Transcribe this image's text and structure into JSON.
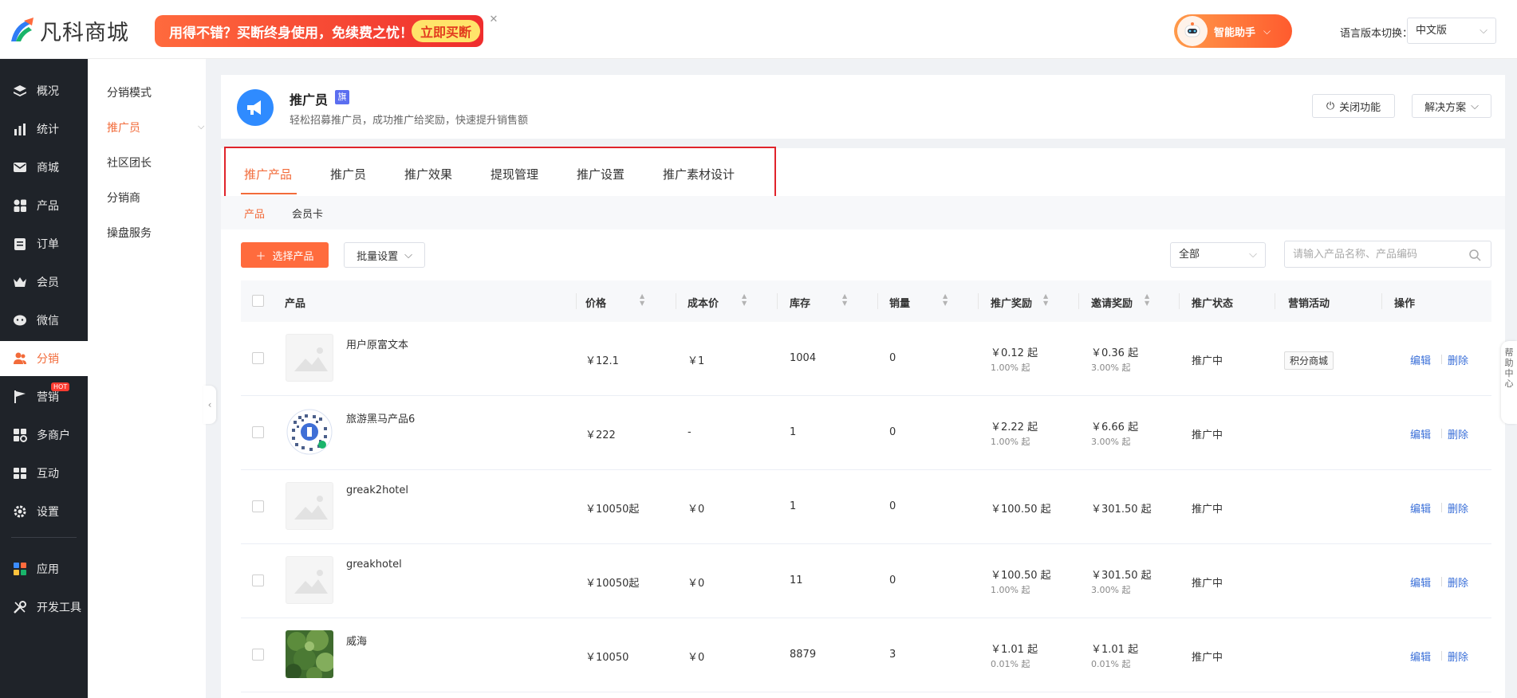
{
  "topbar": {
    "logo_text": "凡科商城",
    "promo_text": "用得不错？买断终身使用，免续费之忧！",
    "promo_button": "立即买断",
    "assistant_label": "智能助手",
    "lang_label": "语言版本切换：",
    "lang_value": "中文版"
  },
  "nav": {
    "items": [
      {
        "label": "概况",
        "icon": "layers-icon"
      },
      {
        "label": "统计",
        "icon": "stats-icon"
      },
      {
        "label": "商城",
        "icon": "mail-icon"
      },
      {
        "label": "产品",
        "icon": "grid-icon"
      },
      {
        "label": "订单",
        "icon": "clipboard-icon"
      },
      {
        "label": "会员",
        "icon": "crown-icon"
      },
      {
        "label": "微信",
        "icon": "wechat-icon"
      },
      {
        "label": "分销",
        "icon": "users-icon"
      },
      {
        "label": "营销",
        "icon": "flag-icon",
        "badge": "HOT"
      },
      {
        "label": "多商户",
        "icon": "store-icon"
      },
      {
        "label": "互动",
        "icon": "interact-icon"
      },
      {
        "label": "设置",
        "icon": "gear-icon"
      },
      {
        "label": "应用",
        "icon": "apps-icon"
      },
      {
        "label": "开发工具",
        "icon": "tools-icon"
      }
    ]
  },
  "subnav": {
    "items": [
      "分销模式",
      "推广员",
      "社区团长",
      "分销商",
      "操盘服务"
    ]
  },
  "header": {
    "title": "推广员",
    "badge": "旗",
    "desc": "轻松招募推广员，成功推广给奖励，快速提升销售额",
    "close_btn": "关闭功能",
    "solution_btn": "解决方案"
  },
  "tabs": [
    "推广产品",
    "推广员",
    "推广效果",
    "提现管理",
    "推广设置",
    "推广素材设计"
  ],
  "subtabs": [
    "产品",
    "会员卡"
  ],
  "toolbar": {
    "select_btn": "选择产品",
    "batch_btn": "批量设置",
    "filter_value": "全部",
    "search_placeholder": "请输入产品名称、产品编码"
  },
  "table": {
    "headers": [
      "产品",
      "价格",
      "成本价",
      "库存",
      "销量",
      "推广奖励",
      "邀请奖励",
      "推广状态",
      "营销活动",
      "操作"
    ],
    "rows": [
      {
        "name": "用户原富文本",
        "price": "￥12.1",
        "cost": "￥1",
        "stock": "1004",
        "sales": "0",
        "reward": "￥0.12 起",
        "reward_pct": "1.00% 起",
        "invite": "￥0.36 起",
        "invite_pct": "3.00% 起",
        "status": "推广中",
        "activity": "积分商城",
        "edit": "编辑",
        "del": "删除"
      },
      {
        "name": "旅游黑马产品6",
        "price": "￥222",
        "cost": "-",
        "stock": "1",
        "sales": "0",
        "reward": "￥2.22 起",
        "reward_pct": "1.00% 起",
        "invite": "￥6.66 起",
        "invite_pct": "3.00% 起",
        "status": "推广中",
        "activity": "",
        "edit": "编辑",
        "del": "删除"
      },
      {
        "name": "greak2hotel",
        "price": "￥10050起",
        "cost": "￥0",
        "stock": "1",
        "sales": "0",
        "reward": "￥100.50 起",
        "reward_pct": "",
        "invite": "￥301.50 起",
        "invite_pct": "",
        "status": "推广中",
        "activity": "",
        "edit": "编辑",
        "del": "删除"
      },
      {
        "name": "greakhotel",
        "price": "￥10050起",
        "cost": "￥0",
        "stock": "11",
        "sales": "0",
        "reward": "￥100.50 起",
        "reward_pct": "1.00% 起",
        "invite": "￥301.50 起",
        "invite_pct": "3.00% 起",
        "status": "推广中",
        "activity": "",
        "edit": "编辑",
        "del": "删除"
      },
      {
        "name": "威海",
        "price": "￥10050",
        "cost": "￥0",
        "stock": "8879",
        "sales": "3",
        "reward": "￥1.01 起",
        "reward_pct": "0.01% 起",
        "invite": "￥1.01 起",
        "invite_pct": "0.01% 起",
        "status": "推广中",
        "activity": "",
        "edit": "编辑",
        "del": "删除"
      }
    ]
  },
  "help_tab": "帮助中心",
  "colors": {
    "accent": "#f26b3a",
    "link": "#3a6fd8",
    "nav_bg": "#1f2329",
    "highlight_box": "#e0242b"
  }
}
